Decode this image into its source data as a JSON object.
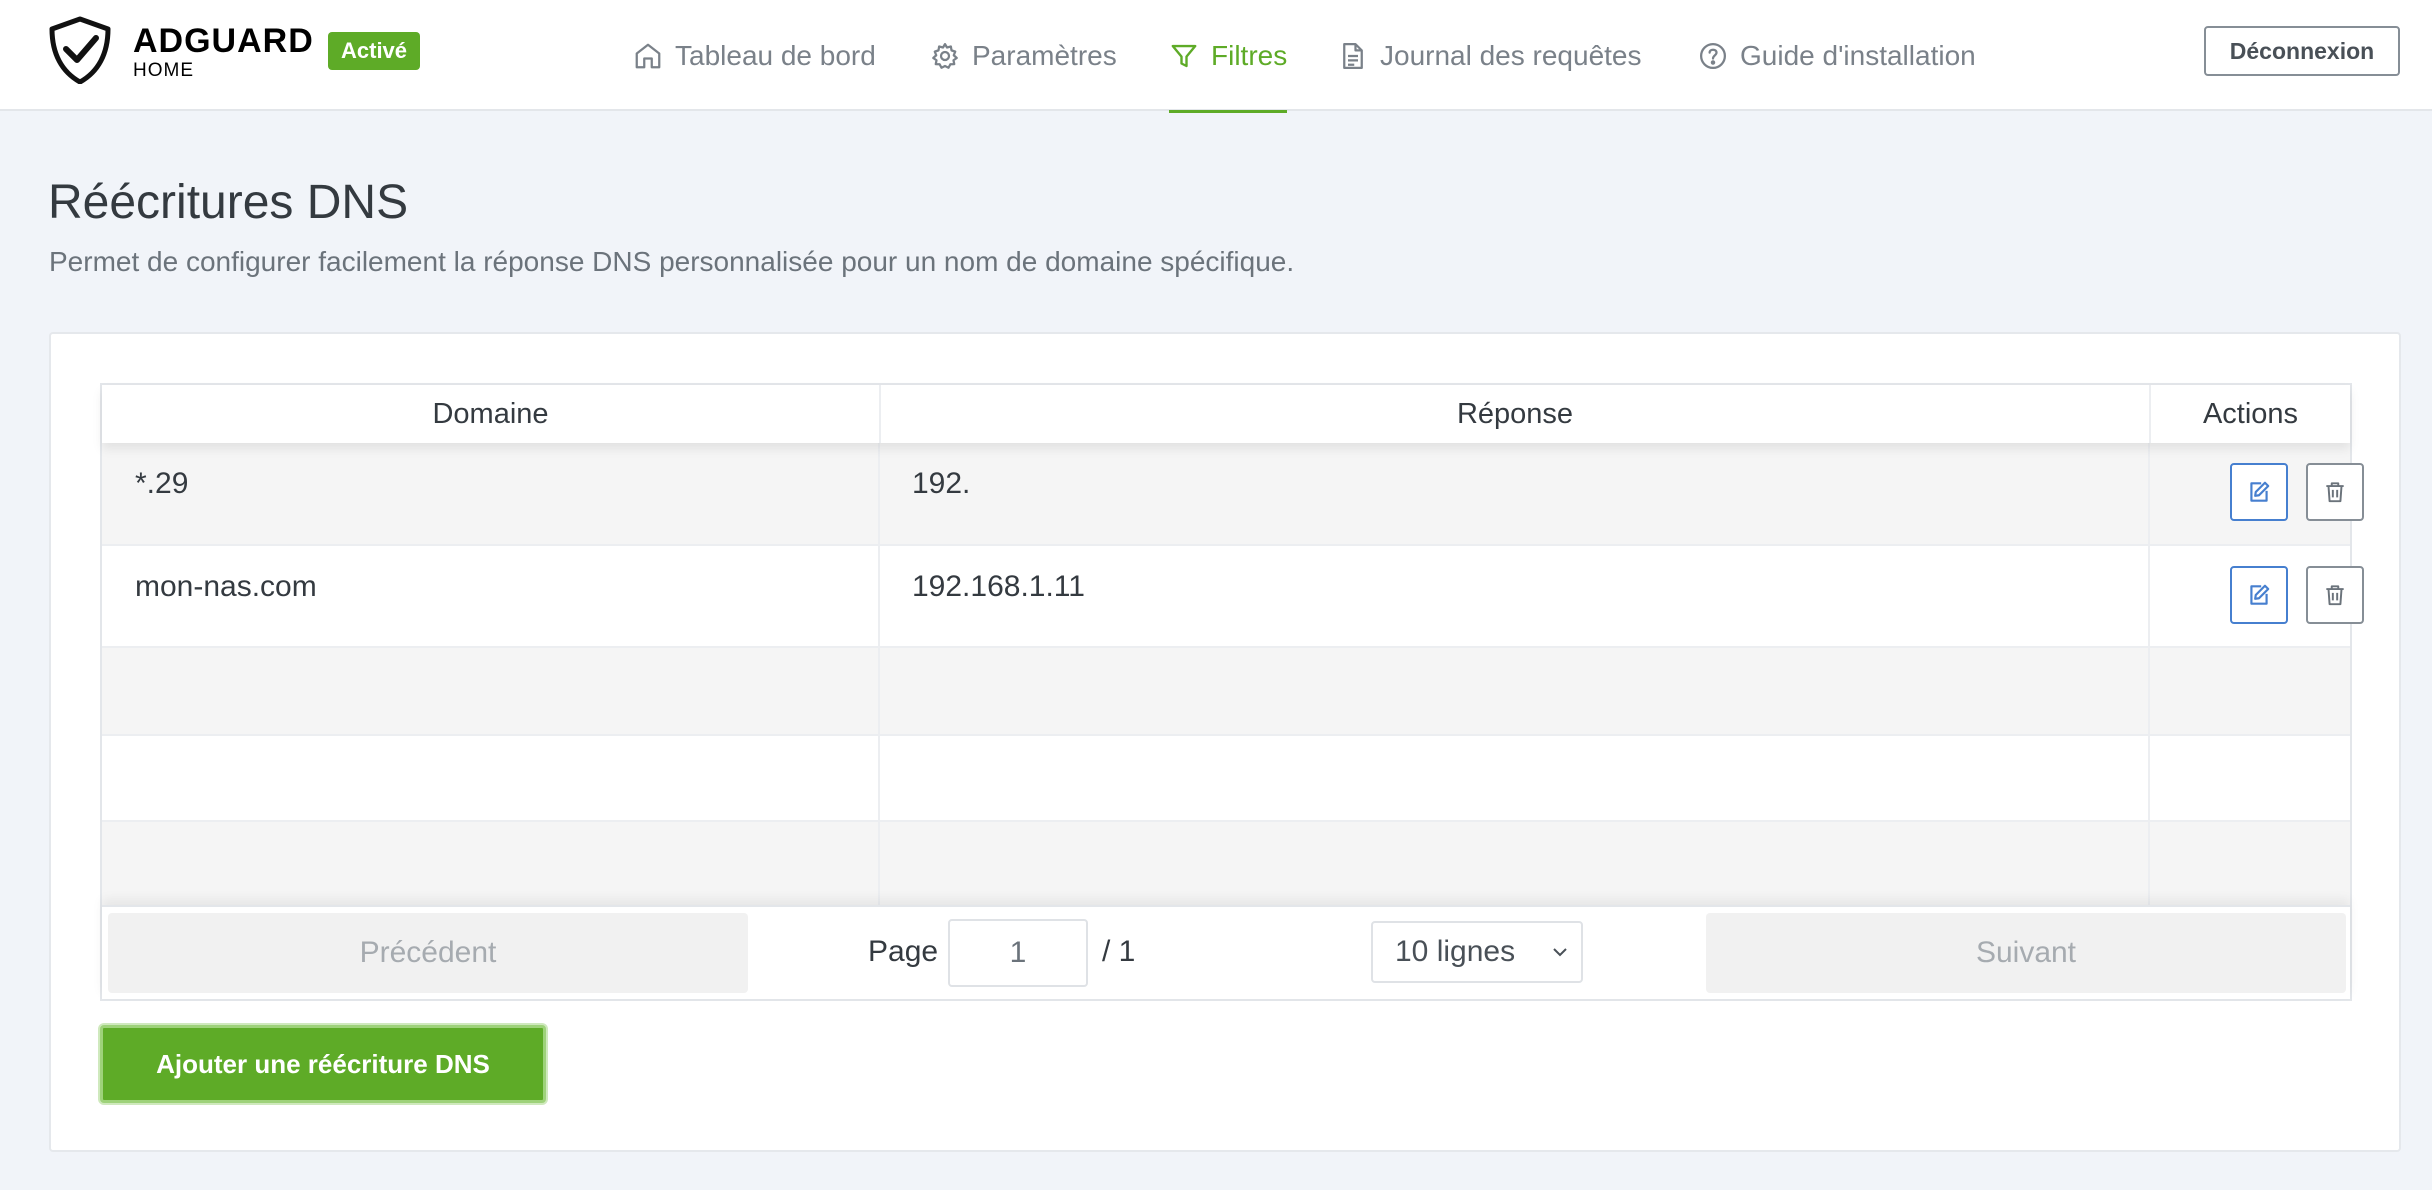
{
  "brand": {
    "name": "ADGUARD",
    "sub": "HOME",
    "status": "Activé"
  },
  "nav": {
    "items": [
      {
        "label": "Tableau de bord",
        "icon": "home-icon"
      },
      {
        "label": "Paramètres",
        "icon": "gear-icon"
      },
      {
        "label": "Filtres",
        "icon": "filter-icon",
        "active": true
      },
      {
        "label": "Journal des requêtes",
        "icon": "document-icon"
      },
      {
        "label": "Guide d'installation",
        "icon": "help-icon"
      }
    ],
    "logout": "Déconnexion"
  },
  "page": {
    "title": "Réécritures DNS",
    "description": "Permet de configurer facilement la réponse DNS personnalisée pour un nom de domaine spécifique."
  },
  "table": {
    "headers": {
      "domain": "Domaine",
      "answer": "Réponse",
      "actions": "Actions"
    },
    "rows": [
      {
        "domain": "*.29",
        "answer": "192."
      },
      {
        "domain": "mon-nas.com",
        "answer": "192.168.1.11"
      }
    ]
  },
  "pagination": {
    "previous": "Précédent",
    "page_label": "Page",
    "page_value": "1",
    "page_total": "/ 1",
    "rows_per_page": "10 lignes",
    "next": "Suivant"
  },
  "add_button": "Ajouter une réécriture DNS",
  "colors": {
    "accent": "#5eab27",
    "edit": "#467fcf",
    "background": "#f1f4f9"
  }
}
